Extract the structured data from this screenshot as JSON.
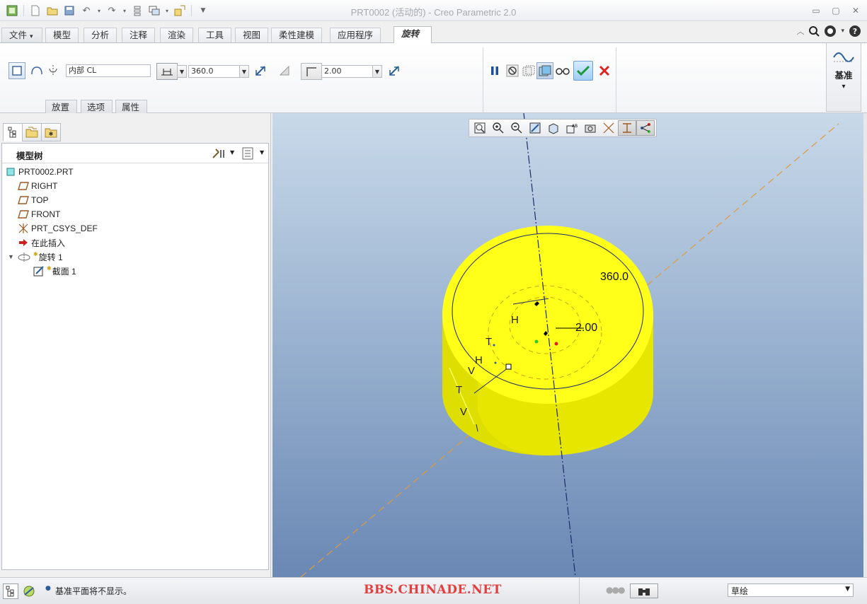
{
  "window": {
    "title": "PRT0002 (活动的) - Creo Parametric 2.0"
  },
  "quick_access": {
    "icons": [
      "app-icon",
      "new-icon",
      "open-icon",
      "save-icon",
      "undo-icon",
      "redo-icon",
      "regenerate-icon",
      "windows-icon",
      "close-window-icon",
      "customize-icon"
    ]
  },
  "ribbon": {
    "tabs": [
      {
        "label": "文件"
      },
      {
        "label": "模型"
      },
      {
        "label": "分析"
      },
      {
        "label": "注释"
      },
      {
        "label": "渲染"
      },
      {
        "label": "工具"
      },
      {
        "label": "视图"
      },
      {
        "label": "柔性建模"
      },
      {
        "label": "应用程序"
      },
      {
        "label": "旋转"
      }
    ],
    "file_arrow": "▾",
    "axis_field": "内部 CL",
    "angle_value": "360.0",
    "thickness_value": "2.00",
    "subtabs": [
      "放置",
      "选项",
      "属性"
    ],
    "datum_label": "基准",
    "datum_arrow": "▾"
  },
  "model_tree": {
    "title": "模型树",
    "items": [
      {
        "label": "PRT0002.PRT",
        "icon": "part-icon"
      },
      {
        "label": "RIGHT",
        "icon": "datum-plane-icon"
      },
      {
        "label": "TOP",
        "icon": "datum-plane-icon"
      },
      {
        "label": "FRONT",
        "icon": "datum-plane-icon"
      },
      {
        "label": "PRT_CSYS_DEF",
        "icon": "csys-icon"
      },
      {
        "label": "在此插入",
        "icon": "insert-here-arrow-icon"
      },
      {
        "label": "旋转 1",
        "icon": "revolve-icon"
      },
      {
        "label": "截面 1",
        "icon": "sketch-icon"
      }
    ]
  },
  "viewport": {
    "dim_angle": "360.0",
    "dim_thickness": "2.00",
    "constraint_labels": [
      "H",
      "T",
      "H",
      "V",
      "T",
      "V"
    ],
    "model_color": "#ffff1a",
    "background_top": "#c8d9e9",
    "background_bottom": "#6a88b4"
  },
  "status": {
    "message": "基准平面将不显示。",
    "watermark": "BBS.CHINADE.NET",
    "filter": "草绘"
  }
}
